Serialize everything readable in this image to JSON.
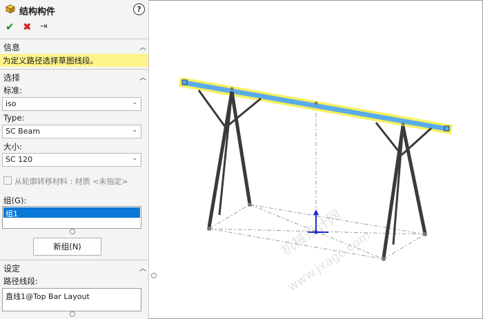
{
  "header": {
    "title": "结构构件",
    "help": "?"
  },
  "actions": {
    "ok": "✔",
    "cancel": "✖",
    "pin": "⇥"
  },
  "info": {
    "title": "信息",
    "message": "为定义路径选择草图线段。"
  },
  "selection": {
    "title": "选择",
    "standard_label": "标准:",
    "standard_value": "iso",
    "type_label": "Type:",
    "type_value": "SC Beam",
    "size_label": "大小:",
    "size_value": "SC 120",
    "transfer_material_label": "从轮廓转移材料 : 材质 <未指定>",
    "transfer_material_checked": false,
    "group_label": "组(G):",
    "groups": [
      "组1"
    ],
    "new_group_button": "新组(N)"
  },
  "settings": {
    "title": "设定",
    "path_segments_label": "路径线段:",
    "path_segments_value": "直线1@Top Bar Layout"
  },
  "viewport": {
    "watermark_cn": "机械设计网",
    "watermark_url": "www.jxagc.com"
  },
  "colors": {
    "selection_highlight": "#f5f060",
    "beam_selected": "#5aabe8",
    "message_bg": "#fdf58c",
    "list_selected": "#0a78d7"
  }
}
